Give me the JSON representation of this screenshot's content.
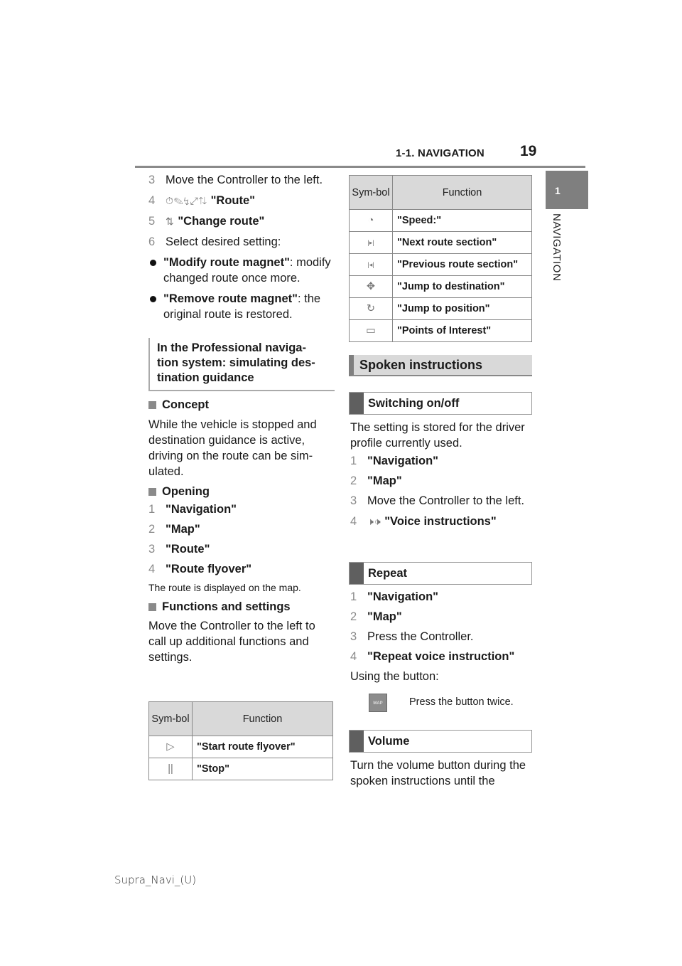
{
  "header": {
    "section_title": "1-1. NAVIGATION",
    "page_number": "19",
    "chapter_tab": "1",
    "side_label": "NAVIGATION"
  },
  "left": {
    "steps_top": [
      {
        "num": "3",
        "text": "Move the Controller to the left."
      },
      {
        "num": "4",
        "icons": "⏱✎↯⤢⇅",
        "label": "\"Route\""
      },
      {
        "num": "5",
        "icons": "⇅",
        "label": "\"Change route\""
      },
      {
        "num": "6",
        "text": "Select desired setting:"
      }
    ],
    "bullets": [
      {
        "bold": "\"Modify route magnet\"",
        "rest": ": modify changed route once more."
      },
      {
        "bold": "\"Remove route magnet\"",
        "rest": ": the original route is restored."
      }
    ],
    "section_heading": "In the Professional naviga-tion system: simulating des-tination guidance",
    "concept": {
      "heading": "Concept",
      "text": "While the vehicle is stopped and destination guidance is active, driving on the route can be sim-ulated."
    },
    "opening": {
      "heading": "Opening",
      "steps": [
        {
          "num": "1",
          "label": "\"Navigation\""
        },
        {
          "num": "2",
          "label": "\"Map\""
        },
        {
          "num": "3",
          "label": "\"Route\""
        },
        {
          "num": "4",
          "label": "\"Route flyover\""
        }
      ],
      "note": "The route is displayed on the map."
    },
    "functions": {
      "heading": "Functions and settings",
      "text": "Move the Controller to the left to call up additional functions and settings."
    },
    "table": {
      "col_symbol": "Sym-bol",
      "col_function": "Function",
      "rows": [
        {
          "icon": "play-outline-icon",
          "glyph": "▷",
          "function": "\"Start route flyover\""
        },
        {
          "icon": "pause-icon",
          "glyph": "||",
          "function": "\"Stop\""
        }
      ]
    }
  },
  "right": {
    "table": {
      "col_symbol": "Sym-bol",
      "col_function": "Function",
      "rows": [
        {
          "icon": "speedometer-icon",
          "glyph": "◔",
          "function": "\"Speed:\""
        },
        {
          "icon": "next-section-icon",
          "glyph": "|▸|",
          "function": "\"Next route section\""
        },
        {
          "icon": "previous-section-icon",
          "glyph": "|◂|",
          "function": "\"Previous route section\""
        },
        {
          "icon": "jump-destination-icon",
          "glyph": "✥",
          "function": "\"Jump to destination\""
        },
        {
          "icon": "jump-position-icon",
          "glyph": "↻",
          "function": "\"Jump to position\""
        },
        {
          "icon": "points-of-interest-icon",
          "glyph": "▭",
          "function": "\"Points of Interest\""
        }
      ]
    },
    "spoken_heading": "Spoken instructions",
    "switching": {
      "heading": "Switching on/off",
      "intro": "The setting is stored for the driver profile currently used.",
      "steps": [
        {
          "num": "1",
          "label": "\"Navigation\""
        },
        {
          "num": "2",
          "label": "\"Map\""
        },
        {
          "num": "3",
          "text": "Move the Controller to the left."
        },
        {
          "num": "4",
          "icons": "🕨🕩",
          "label": "\"Voice instructions\""
        }
      ]
    },
    "repeat": {
      "heading": "Repeat",
      "steps": [
        {
          "num": "1",
          "label": "\"Navigation\""
        },
        {
          "num": "2",
          "label": "\"Map\""
        },
        {
          "num": "3",
          "text": "Press the Controller."
        },
        {
          "num": "4",
          "label": "\"Repeat voice instruction\""
        }
      ],
      "using_button": "Using the button:",
      "map_button_label": "MAP",
      "press_text": "Press the button twice."
    },
    "volume": {
      "heading": "Volume",
      "text": "Turn the volume button during the spoken instructions until the"
    }
  },
  "footer": "Supra_Navi_(U)"
}
